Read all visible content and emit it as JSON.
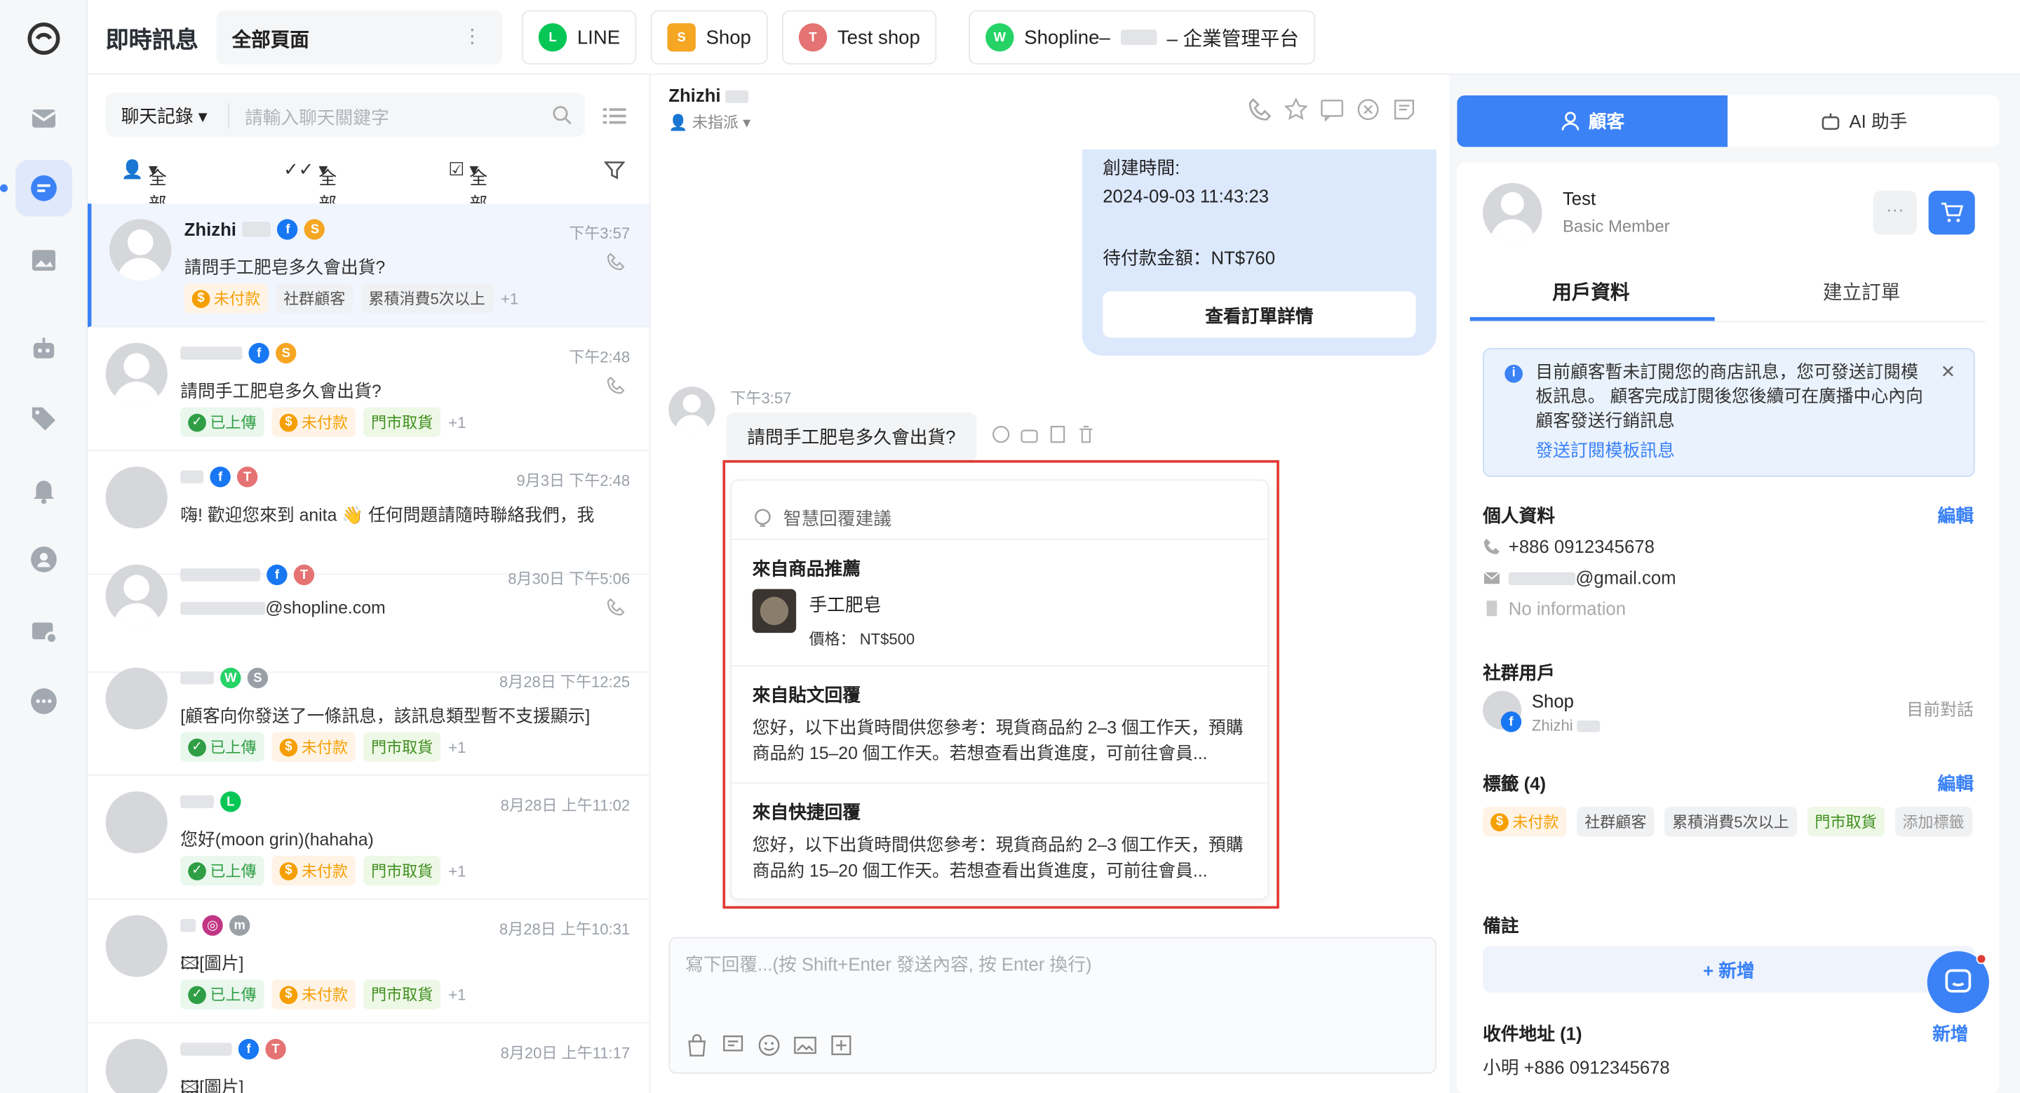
{
  "app": {
    "title": "即時訊息",
    "page_selector": "全部頁面"
  },
  "channels": [
    {
      "label": "LINE",
      "color": "#06c755"
    },
    {
      "label": "Shop",
      "color": "#1877f2"
    },
    {
      "label": "Test shop",
      "color": "#e74c3c"
    },
    {
      "label": "Shopline–",
      "suffix": "– 企業管理平台",
      "color": "#25d366"
    }
  ],
  "list": {
    "search_select": "聊天記錄",
    "search_placeholder": "請輸入聊天關鍵字",
    "filter1": "全部",
    "filter2": "全部",
    "filter3": "全部",
    "conversations": [
      {
        "name": "Zhizhi",
        "time": "下午3:57",
        "msg": "請問手工肥皂多久會出貨?",
        "tags": [
          "未付款",
          "社群顧客",
          "累積消費5次以上"
        ],
        "more": "+1"
      },
      {
        "name": "",
        "time": "下午2:48",
        "msg": "請問手工肥皂多久會出貨?",
        "tags": [
          "已上傳",
          "未付款",
          "門市取貨"
        ],
        "more": "+1"
      },
      {
        "name": "",
        "time": "9月3日 下午2:48",
        "msg": "嗨! 歡迎您來到 anita 👋 任何問題請隨時聯絡我們，我"
      },
      {
        "name": "",
        "time": "8月30日 下午5:06",
        "msg": "@shopline.com"
      },
      {
        "name": "",
        "time": "8月28日 下午12:25",
        "msg": "[顧客向你發送了一條訊息，該訊息類型暫不支援顯示]",
        "tags": [
          "已上傳",
          "未付款",
          "門市取貨"
        ],
        "more": "+1"
      },
      {
        "name": "",
        "time": "8月28日 上午11:02",
        "msg": "您好(moon grin)(hahaha)",
        "tags": [
          "已上傳",
          "未付款",
          "門市取貨"
        ],
        "more": "+1"
      },
      {
        "name": "",
        "time": "8月28日 上午10:31",
        "msg": "[圖片]",
        "tags": [
          "已上傳",
          "未付款",
          "門市取貨"
        ],
        "more": "+1"
      },
      {
        "name": "",
        "time": "8月20日 上午11:17",
        "msg": "[圖片]"
      }
    ]
  },
  "chat": {
    "contact": "Zhizhi",
    "assign": "未指派",
    "order_created_label": "創建時間:",
    "order_created": "2024-09-03 11:43:23",
    "order_amount": "待付款金額：NT$760",
    "order_button": "查看訂單詳情",
    "msg_time": "下午3:57",
    "msg_text": "請問手工肥皂多久會出貨?",
    "suggest_title": "智慧回覆建議",
    "sec1_title": "來自商品推薦",
    "product_name": "手工肥皂",
    "product_price": "價格： NT$500",
    "sec2_title": "來自貼文回覆",
    "sec2_text": "您好，以下出貨時間供您參考：現貨商品約 2–3 個工作天，預購商品約 15–20 個工作天。若想查看出貨進度，可前往會員...",
    "sec3_title": "來自快捷回覆",
    "sec3_text": "您好，以下出貨時間供您參考：現貨商品約 2–3 個工作天，預購商品約 15–20 個工作天。若想查看出貨進度，可前往會員...",
    "composer_placeholder": "寫下回覆...(按 Shift+Enter 發送內容, 按 Enter 換行)"
  },
  "panel": {
    "tab_customer": "顧客",
    "tab_ai": "AI 助手",
    "name": "Test",
    "level": "Basic Member",
    "more": "···",
    "subtab1": "用戶資料",
    "subtab2": "建立訂單",
    "notice": "目前顧客暫未訂閱您的商店訊息，您可發送訂閱模板訊息。 顧客完成訂閱後您後續可在廣播中心內向顧客發送行銷訊息",
    "notice_link": "發送訂閱模板訊息",
    "personal": "個人資料",
    "edit": "編輯",
    "phone": "+886 0912345678",
    "email": "@gmail.com",
    "no_info": "No information",
    "social": "社群用戶",
    "social_name": "Shop",
    "social_sub": "Zhizhi",
    "current": "目前對話",
    "tags_title": "標籤 (4)",
    "tags_edit": "編輯",
    "tags": [
      "未付款",
      "社群顧客",
      "累積消費5次以上",
      "門市取貨"
    ],
    "add_tag": "添加標籤",
    "notes": "備註",
    "add_note": "+ 新增",
    "address": "收件地址 (1)",
    "address_add": "新增",
    "address_line": "小明 +886 0912345678"
  }
}
